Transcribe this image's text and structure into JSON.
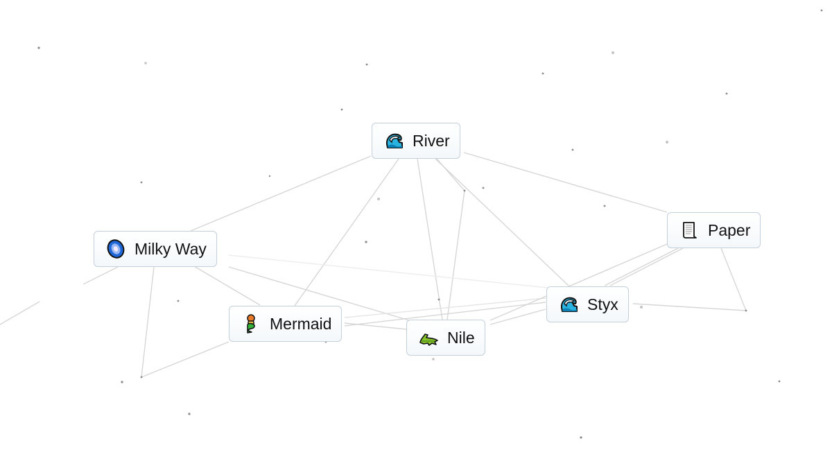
{
  "app": "Infinite Craft canvas",
  "elements": [
    {
      "id": "river",
      "label": "River",
      "icon": "water-wave-icon"
    },
    {
      "id": "milky-way",
      "label": "Milky Way",
      "icon": "galaxy-icon"
    },
    {
      "id": "mermaid",
      "label": "Mermaid",
      "icon": "mermaid-icon"
    },
    {
      "id": "nile",
      "label": "Nile",
      "icon": "crocodile-icon"
    },
    {
      "id": "styx",
      "label": "Styx",
      "icon": "water-wave-icon"
    },
    {
      "id": "paper",
      "label": "Paper",
      "icon": "scroll-page-icon"
    }
  ],
  "colors": {
    "background": "#ffffff",
    "tile_border": "#c3cfd9",
    "connection_line": "#d8d8d8",
    "dot": "#8a8a8a"
  }
}
